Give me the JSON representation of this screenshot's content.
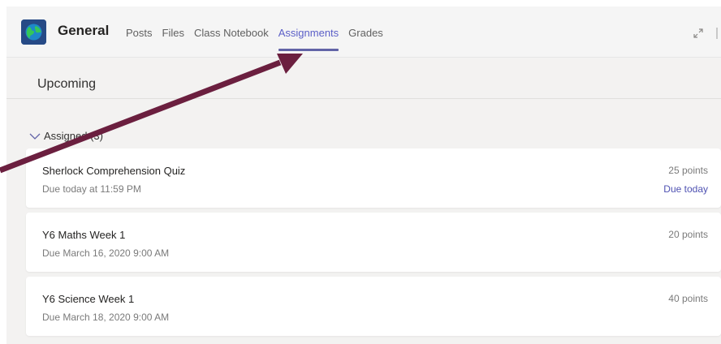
{
  "header": {
    "team_name": "General",
    "tabs": [
      {
        "label": "Posts",
        "active": false
      },
      {
        "label": "Files",
        "active": false
      },
      {
        "label": "Class Notebook",
        "active": false
      },
      {
        "label": "Assignments",
        "active": true
      },
      {
        "label": "Grades",
        "active": false
      }
    ]
  },
  "section": {
    "title": "Upcoming",
    "group_label": "Assigned (3)"
  },
  "assignments": [
    {
      "title": "Sherlock Comprehension Quiz",
      "due": "Due today at 11:59 PM",
      "points": "25 points",
      "status": "Due today"
    },
    {
      "title": "Y6 Maths Week 1",
      "due": "Due March 16, 2020 9:00 AM",
      "points": "20 points",
      "status": ""
    },
    {
      "title": "Y6 Science Week 1",
      "due": "Due March 18, 2020 9:00 AM",
      "points": "40 points",
      "status": ""
    }
  ],
  "icons": {
    "team_logo": "globe-icon",
    "expand": "expand-icon",
    "group_toggle": "chevron-down-icon"
  },
  "colors": {
    "accent": "#6264a7",
    "arrow": "#6b1f3f",
    "due_today": "#4f52b2"
  }
}
